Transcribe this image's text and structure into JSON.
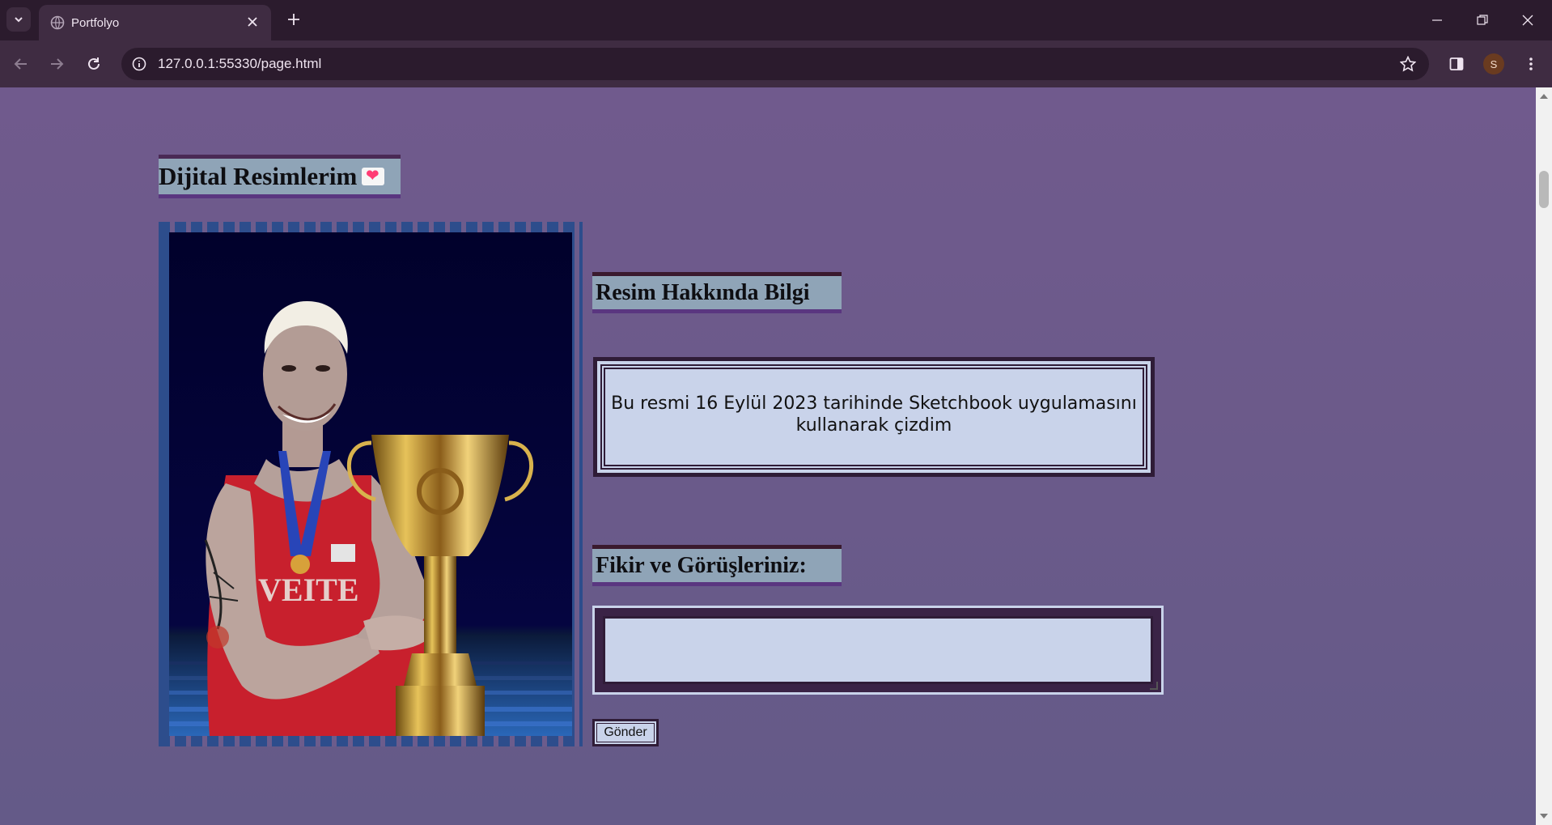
{
  "browser": {
    "tab_title": "Portfolyo",
    "url": "127.0.0.1:55330/page.html",
    "profile_initial": "S"
  },
  "page": {
    "gallery_heading": "Dijital Resimlerim",
    "info_heading": "Resim Hakkında Bilgi",
    "info_text": "Bu resmi 16 Eylül 2023 tarihinde Sketchbook uygulamasını kullanarak çizdim",
    "opinion_heading": "Fikir ve Görüşleriniz:",
    "comment_value": "",
    "submit_label": "Gönder"
  },
  "icons": {
    "tab_list": "chevron-down-icon",
    "favicon": "globe-icon",
    "close_tab": "close-icon",
    "new_tab": "plus-icon",
    "back": "arrow-left-icon",
    "forward": "arrow-right-icon",
    "reload": "reload-icon",
    "site_info": "info-icon",
    "bookmark": "star-icon",
    "side_panel": "side-panel-icon",
    "menu": "kebab-menu-icon",
    "heading_emoji": "heart-icon"
  }
}
